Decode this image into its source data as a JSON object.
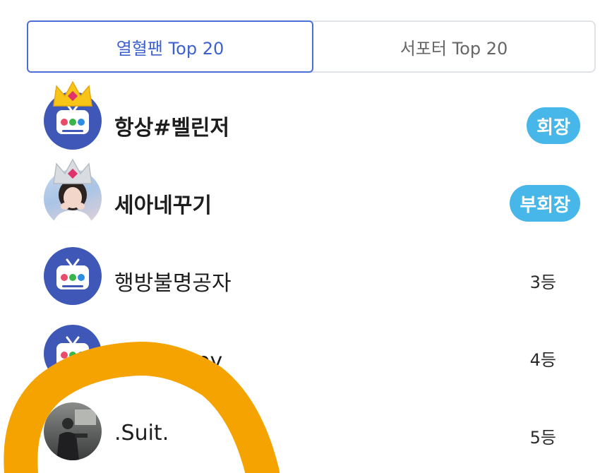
{
  "tabs": {
    "active": "열혈팬 Top 20",
    "other": "서포터 Top 20"
  },
  "ranking": [
    {
      "name": "항상#벨린저",
      "badge": "회장",
      "crown": "gold",
      "avatar": "tv-icon"
    },
    {
      "name": "세아네꾸기",
      "badge": "부회장",
      "crown": "silver",
      "avatar": "profile-photo"
    },
    {
      "name": "행방불명공자",
      "rank": "3등",
      "avatar": "tv-icon"
    },
    {
      "name": "Roy",
      "visible_fragment": "이Roy",
      "rank": "4등",
      "avatar": "tv-icon"
    },
    {
      "name": ".Suit.",
      "rank": "5등",
      "avatar": "profile-photo"
    }
  ],
  "colors": {
    "tab_active": "#4b6fd6",
    "badge": "#47b6e8",
    "scribble": "#f5a300",
    "tv_bg": "#3f58b8"
  }
}
